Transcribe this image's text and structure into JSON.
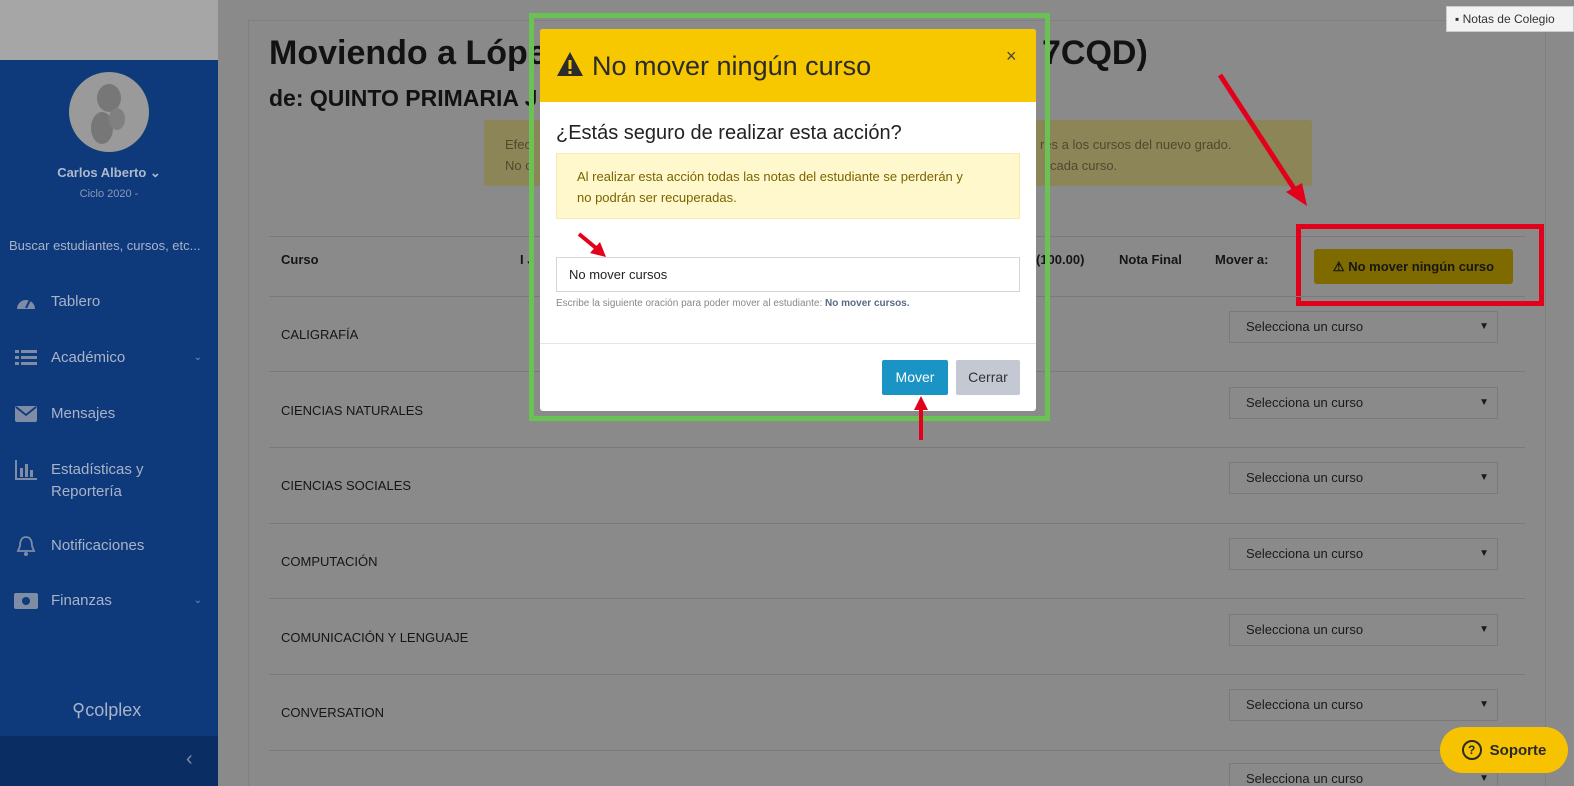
{
  "sidebar": {
    "user_name": "Carlos Alberto",
    "user_cycle": "Ciclo 2020 -",
    "search_placeholder": "Buscar estudiantes, cursos, etc...",
    "items": [
      {
        "label": "Tablero",
        "icon": "dashboard-icon"
      },
      {
        "label": "Académico",
        "icon": "list-icon",
        "has_chevron": true
      },
      {
        "label": "Mensajes",
        "icon": "envelope-icon"
      },
      {
        "label": "Estadísticas y",
        "label2": "Reportería",
        "icon": "bar-chart-icon"
      },
      {
        "label": "Notificaciones",
        "icon": "bell-icon"
      },
      {
        "label": "Finanzas",
        "icon": "money-icon",
        "has_chevron": true
      }
    ],
    "brand": "colplex"
  },
  "page": {
    "title_start": "Moviendo a Lópe",
    "title_end": "7CQD)",
    "subtitle": "de: QUINTO PRIMARIA",
    "subtitle_tail": "J",
    "banner_left_1": "Efec",
    "banner_left_2": "No c",
    "banner_right_1": "res a los cursos del nuevo grado.",
    "banner_right_2": "cada curso.",
    "table_headers": {
      "curso": "Curso",
      "col2": "I J",
      "col3": "(100.00)",
      "nota_final": "Nota Final",
      "mover_a": "Mover a:"
    },
    "no_move_button": "No mover ningún curso",
    "select_placeholder": "Selecciona un curso",
    "courses": [
      "CALIGRAFÍA",
      "CIENCIAS NATURALES",
      "CIENCIAS SOCIALES",
      "COMPUTACIÓN",
      "COMUNICACIÓN Y LENGUAJE",
      "CONVERSATION"
    ]
  },
  "top_tab": "Notas de Colegio",
  "support": "Soporte",
  "modal": {
    "title": "No mover ningún curso",
    "close": "×",
    "question": "¿Estás seguro de realizar esta acción?",
    "alert_line1": "Al realizar esta acción todas las notas del estudiante se perderán y",
    "alert_line2": "no podrán ser recuperadas.",
    "input_value": "No mover cursos",
    "helper_text": "Escribe la siguiente oración para poder mover al estudiante:",
    "helper_phrase": "No mover cursos.",
    "move_button": "Mover",
    "close_button": "Cerrar"
  },
  "colors": {
    "sidebar": "#0e3a7c",
    "modal_header": "#f7c800",
    "highlight_green": "#6bc254",
    "highlight_red": "#e3001b",
    "primary": "#1a94c4"
  }
}
